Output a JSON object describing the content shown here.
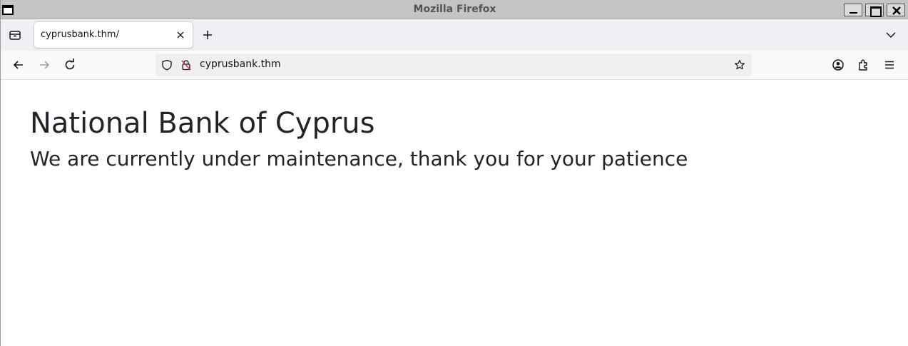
{
  "window": {
    "title": "Mozilla Firefox"
  },
  "tabs": [
    {
      "label": "cyprusbank.thm/",
      "active": true
    }
  ],
  "navbar": {
    "url": "cyprusbank.thm"
  },
  "page": {
    "heading": "National Bank of Cyprus",
    "subheading": "We are currently under maintenance, thank you for your patience"
  },
  "icons": {
    "tab_manager": "tab-manager-icon",
    "tab_close": "close-icon",
    "new_tab": "plus-icon",
    "list_tabs": "chevron-down-icon",
    "back": "arrow-left-icon",
    "forward": "arrow-right-icon",
    "reload": "reload-icon",
    "tracking_protection": "shield-icon",
    "insecure": "insecure-lock-icon",
    "bookmark": "star-icon",
    "account": "account-icon",
    "extensions": "puzzle-icon",
    "menu": "hamburger-icon"
  },
  "colors": {
    "titlebar": "#c4c4c4",
    "tabstrip": "#f0f0f4",
    "navbar": "#f9f9fb",
    "urlbar": "#efeff2",
    "text": "#212529",
    "insecure_accent": "#e22850"
  }
}
